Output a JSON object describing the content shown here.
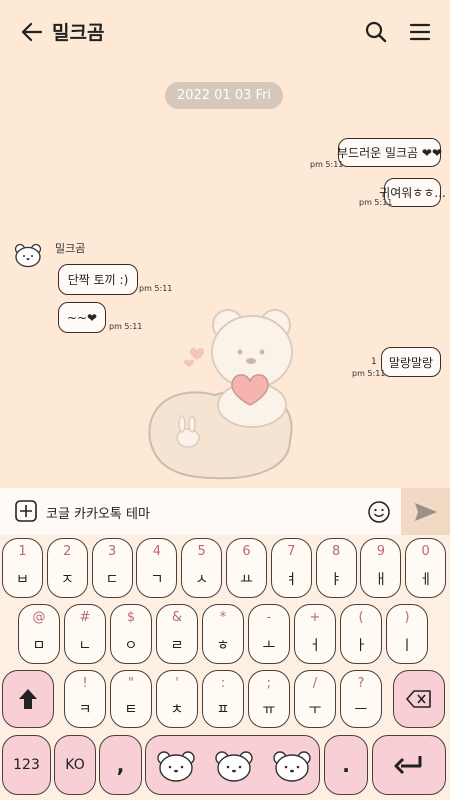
{
  "header": {
    "title": "밀크곰"
  },
  "chat": {
    "date": "2022 01 03 Fri",
    "sender_name": "밀크곰",
    "messages": [
      {
        "text": "부드러운 밀크곰 ❤❤",
        "time": "pm 5:11"
      },
      {
        "text": "귀여워ㅎㅎ...",
        "time": "pm 5:11"
      },
      {
        "text": "단짝 토끼 :)",
        "time": "pm 5:11"
      },
      {
        "text": "~~❤",
        "time": "pm 5:11"
      },
      {
        "text": "말랑말랑",
        "time": "pm 5:11",
        "unread": "1"
      }
    ]
  },
  "input": {
    "text": "코글 카카오톡 테마"
  },
  "keyboard": {
    "row1": [
      {
        "top": "1",
        "main": "ㅂ"
      },
      {
        "top": "2",
        "main": "ㅈ"
      },
      {
        "top": "3",
        "main": "ㄷ"
      },
      {
        "top": "4",
        "main": "ㄱ"
      },
      {
        "top": "5",
        "main": "ㅅ"
      },
      {
        "top": "6",
        "main": "ㅛ"
      },
      {
        "top": "7",
        "main": "ㅕ"
      },
      {
        "top": "8",
        "main": "ㅑ"
      },
      {
        "top": "9",
        "main": "ㅐ"
      },
      {
        "top": "0",
        "main": "ㅔ"
      }
    ],
    "row2": [
      {
        "top": "@",
        "main": "ㅁ"
      },
      {
        "top": "#",
        "main": "ㄴ"
      },
      {
        "top": "$",
        "main": "ㅇ"
      },
      {
        "top": "&",
        "main": "ㄹ"
      },
      {
        "top": "*",
        "main": "ㅎ"
      },
      {
        "top": "-",
        "main": "ㅗ"
      },
      {
        "top": "+",
        "main": "ㅓ"
      },
      {
        "top": "(",
        "main": "ㅏ"
      },
      {
        "top": ")",
        "main": "ㅣ"
      }
    ],
    "row3": [
      {
        "top": "!",
        "main": "ㅋ"
      },
      {
        "top": "\"",
        "main": "ㅌ"
      },
      {
        "top": "'",
        "main": "ㅊ"
      },
      {
        "top": ":",
        "main": "ㅍ"
      },
      {
        "top": ";",
        "main": "ㅠ"
      },
      {
        "top": "/",
        "main": "ㅜ"
      },
      {
        "top": "?",
        "main": "ㅡ"
      }
    ],
    "num_label": "123",
    "lang_label": "KO",
    "comma_label": ",",
    "period_label": "."
  }
}
